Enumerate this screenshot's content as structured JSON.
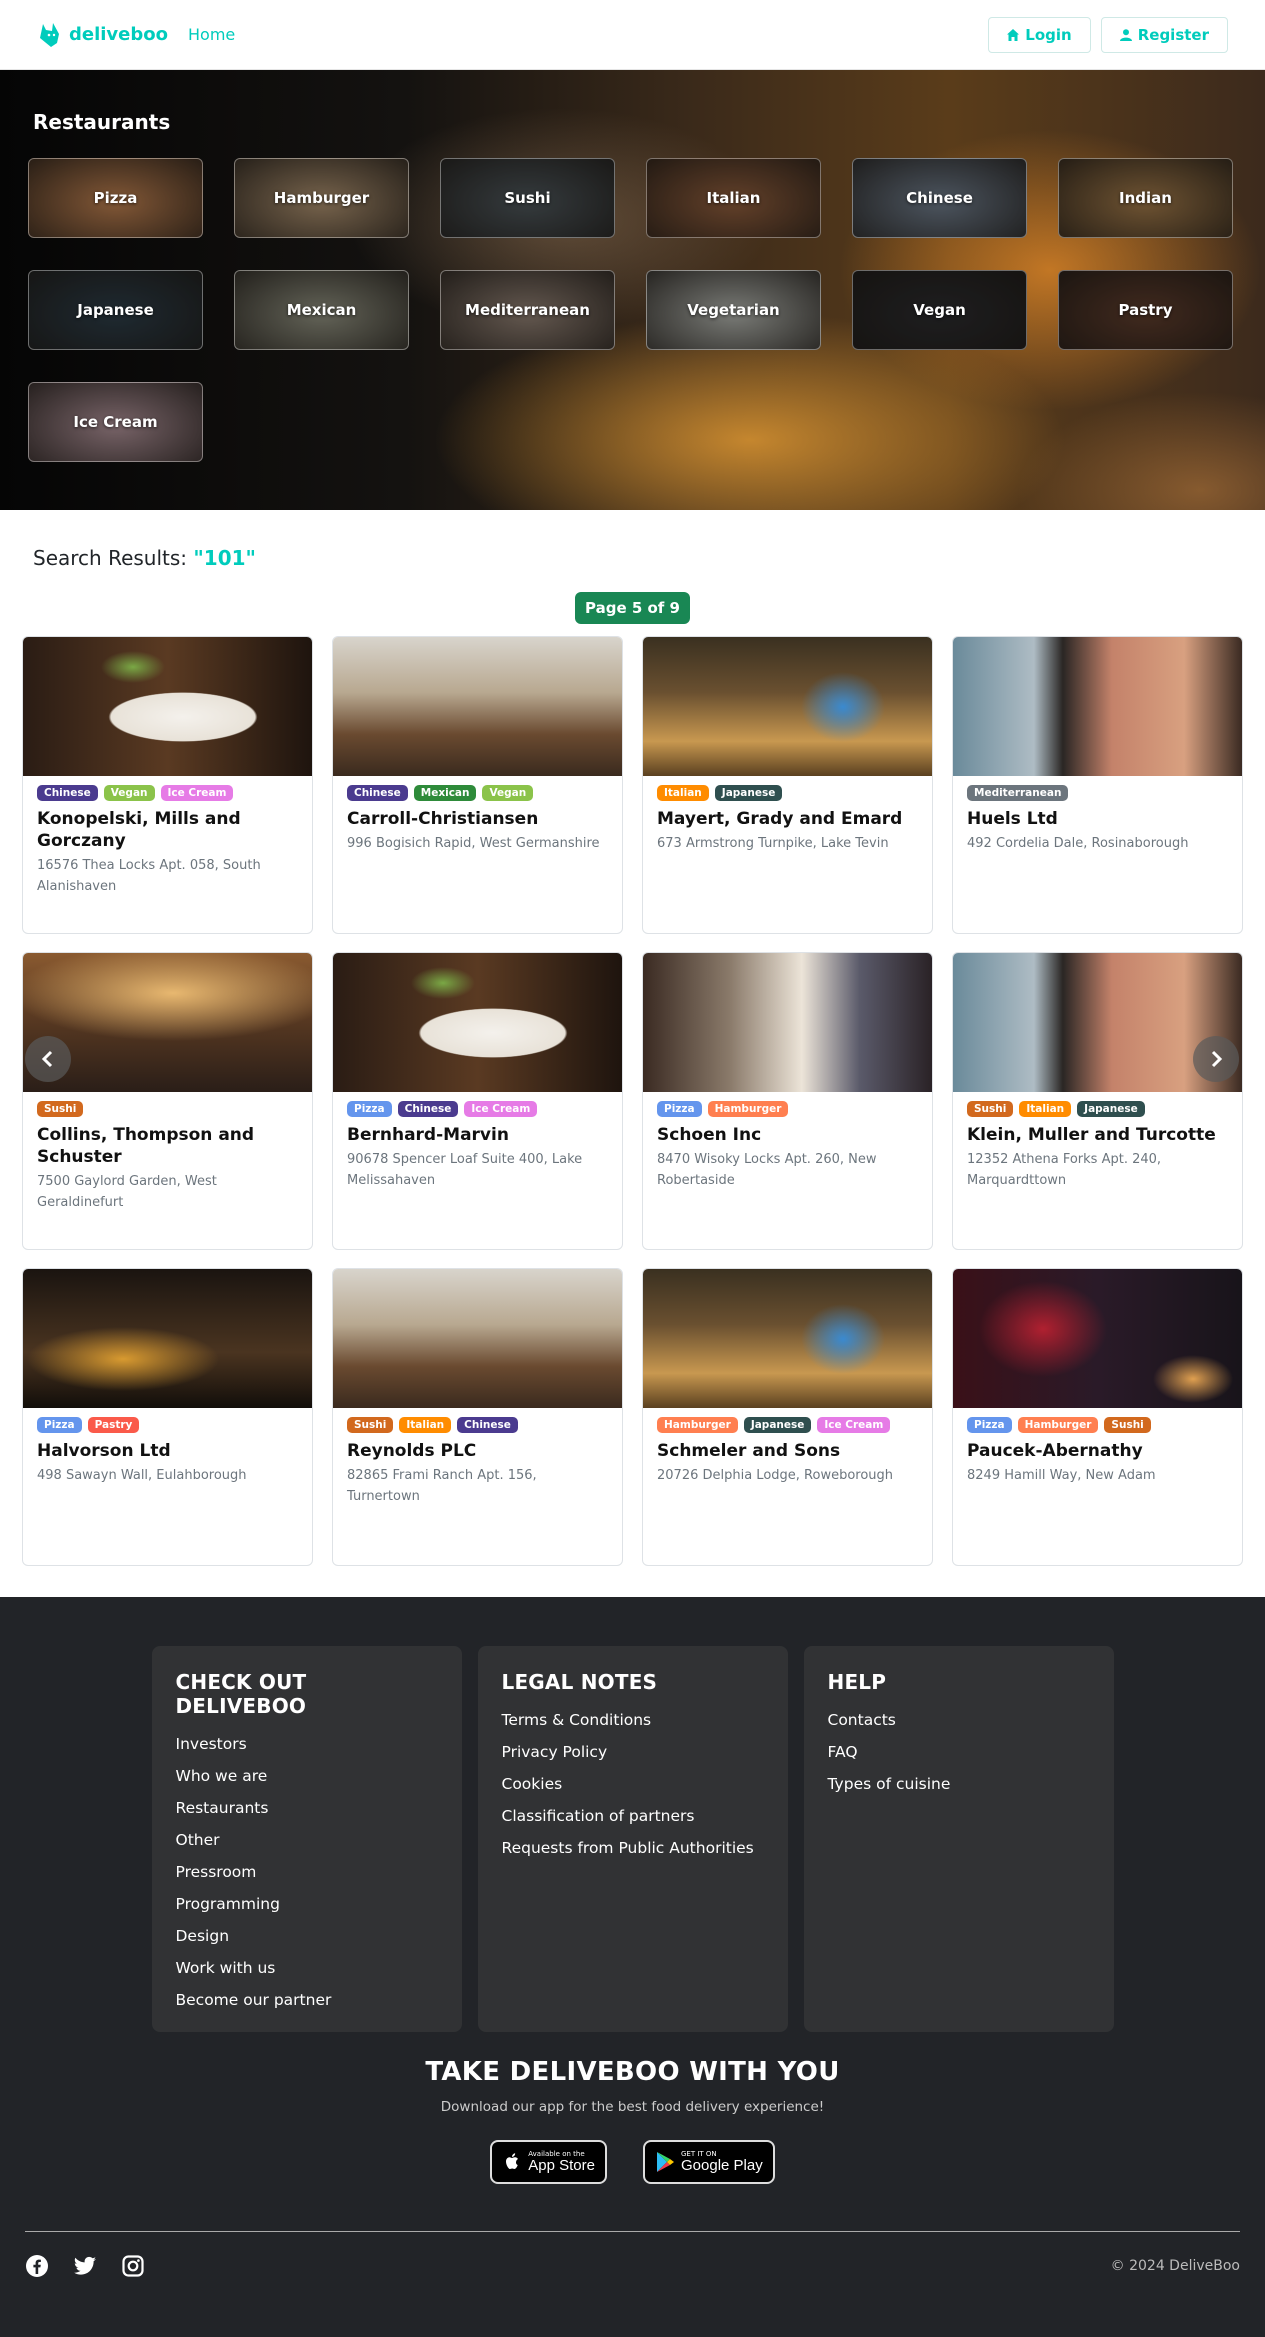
{
  "colors": {
    "accent": "#00ccbc",
    "pager": "#198754",
    "footer_bg": "#222428",
    "footer_card": "#313234"
  },
  "nav": {
    "brand": "deliveboo",
    "home": "Home",
    "login": "Login",
    "register": "Register"
  },
  "hero": {
    "title": "Restaurants",
    "categories": [
      {
        "label": "Pizza",
        "bg": "#b57a4c"
      },
      {
        "label": "Hamburger",
        "bg": "#a58a6a"
      },
      {
        "label": "Sushi",
        "bg": "#4a5256"
      },
      {
        "label": "Italian",
        "bg": "#8a5a3a"
      },
      {
        "label": "Chinese",
        "bg": "#6a7684"
      },
      {
        "label": "Indian",
        "bg": "#9a7446"
      },
      {
        "label": "Japanese",
        "bg": "#2b3a44"
      },
      {
        "label": "Mexican",
        "bg": "#8a8a7a"
      },
      {
        "label": "Mediterranean",
        "bg": "#8a7a6e"
      },
      {
        "label": "Vegetarian",
        "bg": "#a8aaa4"
      },
      {
        "label": "Vegan",
        "bg": "#2a2a2c"
      },
      {
        "label": "Pastry",
        "bg": "#5a3a2a"
      },
      {
        "label": "Ice Cream",
        "bg": "#a68a90"
      }
    ]
  },
  "search": {
    "label": "Search Results:",
    "query": "\"101\"",
    "page_label": "Page 5 of 9"
  },
  "tag_colors": {
    "Chinese": "#4b3b8f",
    "Vegan": "#8bc34a",
    "Ice Cream": "#e67be6",
    "Mexican": "#2e8b3a",
    "Italian": "#ff8c00",
    "Japanese": "#2f4f4f",
    "Mediterranean": "#6c757d",
    "Sushi": "#d2691e",
    "Pizza": "#6495ed",
    "Hamburger": "#ff7f50",
    "Pastry": "#fa5a4a"
  },
  "restaurants": [
    {
      "name": "Konopelski, Mills and Gorczany",
      "address": "16576 Thea Locks Apt. 058, South Alanishaven",
      "tags": [
        "Chinese",
        "Vegan",
        "Ice Cream"
      ],
      "img": "dish"
    },
    {
      "name": "Carroll-Christiansen",
      "address": "996 Bogisich Rapid, West Germanshire",
      "tags": [
        "Chinese",
        "Mexican",
        "Vegan"
      ],
      "img": "hall"
    },
    {
      "name": "Mayert, Grady and Emard",
      "address": "673 Armstrong Turnpike, Lake Tevin",
      "tags": [
        "Italian",
        "Japanese"
      ],
      "img": "cafe"
    },
    {
      "name": "Huels Ltd",
      "address": "492 Cordelia Dale, Rosinaborough",
      "tags": [
        "Mediterranean"
      ],
      "img": "brick"
    },
    {
      "name": "Collins, Thompson and Schuster",
      "address": "7500 Gaylord Garden, West Geraldinefurt",
      "tags": [
        "Sushi"
      ],
      "img": "bar"
    },
    {
      "name": "Bernhard-Marvin",
      "address": "90678 Spencer Loaf Suite 400, Lake Melissahaven",
      "tags": [
        "Pizza",
        "Chinese",
        "Ice Cream"
      ],
      "img": "dish"
    },
    {
      "name": "Schoen Inc",
      "address": "8470 Wisoky Locks Apt. 260, New Robertaside",
      "tags": [
        "Pizza",
        "Hamburger"
      ],
      "img": "dining"
    },
    {
      "name": "Klein, Muller and Turcotte",
      "address": "12352 Athena Forks Apt. 240, Marquardttown",
      "tags": [
        "Sushi",
        "Italian",
        "Japanese"
      ],
      "img": "brick"
    },
    {
      "name": "Halvorson Ltd",
      "address": "498 Sawayn Wall, Eulahborough",
      "tags": [
        "Pizza",
        "Pastry"
      ],
      "img": "night"
    },
    {
      "name": "Reynolds PLC",
      "address": "82865 Frami Ranch Apt. 156, Turnertown",
      "tags": [
        "Sushi",
        "Italian",
        "Chinese"
      ],
      "img": "hall"
    },
    {
      "name": "Schmeler and Sons",
      "address": "20726 Delphia Lodge, Roweborough",
      "tags": [
        "Hamburger",
        "Japanese",
        "Ice Cream"
      ],
      "img": "cafe"
    },
    {
      "name": "Paucek-Abernathy",
      "address": "8249 Hamill Way, New Adam",
      "tags": [
        "Pizza",
        "Hamburger",
        "Sushi"
      ],
      "img": "red"
    }
  ],
  "image_styles": {
    "dish": "radial-gradient(ellipse 120px 40px at 160px 80px, #f4f1ec 0%, #e8e2d8 60%, rgba(0,0,0,0) 62%), radial-gradient(ellipse 50px 18px at 175px 82px, #d4572a, rgba(0,0,0,0) 80%), radial-gradient(ellipse 40px 20px at 110px 30px, #7aa845, rgba(0,0,0,0) 80%), linear-gradient(90deg, #2a1c14, #5a3a22 50%, #1e140e)",
    "hall": "linear-gradient(180deg, #d8d4cc 0%, #b8a890 40%, #6a4a30 70%, #3a2a1e 100%)",
    "cafe": "radial-gradient(ellipse 60px 50px at 200px 70px, #3a8ad0, rgba(0,0,0,0) 70%), linear-gradient(180deg, #3a3020 0%, #6a5030 40%, #c89850 75%, #5a4020 100%)",
    "brick": "linear-gradient(90deg, #6a8a9a 0%, #aebcc4 28%, #2a2624 38%, #c4826a 55%, #d8a080 80%, #3a2a22 100%)",
    "bar": "radial-gradient(ellipse 200px 60px at 150px 40px, #e8b870, rgba(0,0,0,0) 80%), linear-gradient(180deg, #8a5a30 0%, #5a3a22 45%, #2a1e18 100%)",
    "dining": "linear-gradient(90deg, #3a2a22 0%, #8a7a6a 30%, #ece4d8 55%, #5a5a6a 75%, #2a2226 100%)",
    "night": "radial-gradient(ellipse 120px 40px at 100px 90px, #d89a30, rgba(0,0,0,0) 80%), linear-gradient(180deg, #1a1410 0%, #4a3420 60%, #120e0a 100%)",
    "red": "radial-gradient(ellipse 80px 60px at 90px 60px, #b02030, rgba(0,0,0,0) 80%), radial-gradient(ellipse 50px 30px at 240px 110px, #e0a050, rgba(0,0,0,0) 80%), linear-gradient(90deg, #3a1018 0%, #2a1a28 50%, #18141a 100%)"
  },
  "footer": {
    "columns": [
      {
        "title": "CHECK OUT DELIVEBOO",
        "links": [
          "Investors",
          "Who we are",
          "Restaurants",
          "Other",
          "Pressroom",
          "Programming",
          "Design",
          "Work with us",
          "Become our partner"
        ]
      },
      {
        "title": "LEGAL NOTES",
        "links": [
          "Terms & Conditions",
          "Privacy Policy",
          "Cookies",
          "Classification of partners",
          "Requests from Public Authorities"
        ]
      },
      {
        "title": "HELP",
        "links": [
          "Contacts",
          "FAQ",
          "Types of cuisine"
        ]
      }
    ],
    "app_title": "TAKE DELIVEBOO WITH YOU",
    "app_sub": "Download our app for the best food delivery experience!",
    "appstore_small": "Available on the",
    "appstore_big": "App Store",
    "googleplay_small": "GET IT ON",
    "googleplay_big": "Google Play",
    "social_icons": [
      "facebook-icon",
      "twitter-icon",
      "instagram-icon"
    ],
    "copyright": "© 2024 DeliveBoo"
  }
}
